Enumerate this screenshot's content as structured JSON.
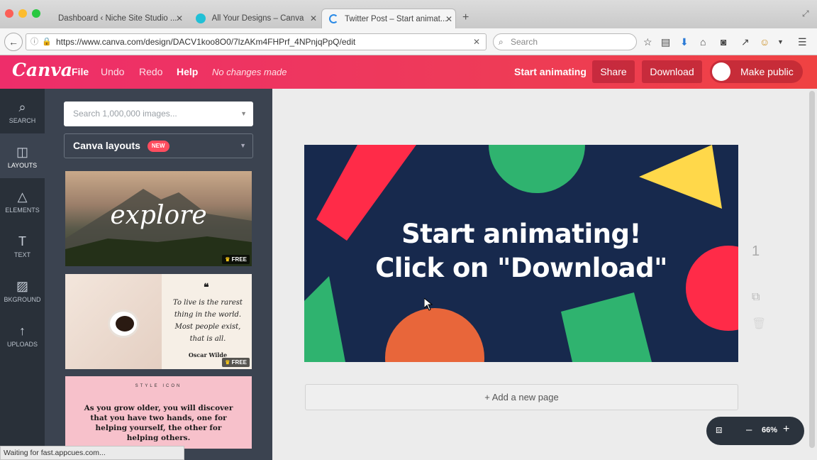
{
  "browser": {
    "tabs": [
      {
        "label": "Dashboard ‹ Niche Site Studio ..."
      },
      {
        "label": "All Your Designs – Canva"
      },
      {
        "label": "Twitter Post – Start animat..."
      }
    ],
    "url": "https://www.canva.com/design/DACV1koo8O0/7lzAKm4FHPrf_4NPnjqPpQ/edit",
    "search_placeholder": "Search"
  },
  "header": {
    "logo": "Canva",
    "menu": {
      "file": "File",
      "undo": "Undo",
      "redo": "Redo",
      "help": "Help"
    },
    "status": "No changes made",
    "start_animating": "Start animating",
    "share": "Share",
    "download": "Download",
    "make_public": "Make public"
  },
  "sidebar": {
    "items": [
      {
        "label": "SEARCH",
        "icon": "search-icon"
      },
      {
        "label": "LAYOUTS",
        "icon": "layouts-icon"
      },
      {
        "label": "ELEMENTS",
        "icon": "elements-icon"
      },
      {
        "label": "TEXT",
        "icon": "text-icon"
      },
      {
        "label": "BKGROUND",
        "icon": "background-icon"
      },
      {
        "label": "UPLOADS",
        "icon": "upload-icon"
      }
    ]
  },
  "panel": {
    "search_placeholder": "Search 1,000,000 images...",
    "category": "Canva layouts",
    "new_badge": "NEW",
    "thumbnails": [
      {
        "script": "explore",
        "badge": "FREE"
      },
      {
        "quote": "To live is the rarest thing in the world. Most people exist, that is all.",
        "author": "Oscar Wilde",
        "badge": "FREE"
      },
      {
        "kicker": "STYLE ICON",
        "quote": "As you grow older, you will discover that you have two hands, one for helping yourself, the other for helping others."
      }
    ]
  },
  "design": {
    "line1": "Start animating!",
    "line2": "Click on \"Download\"",
    "add_page": "+ Add a new page",
    "page_number": "1"
  },
  "zoom": {
    "value": "66%",
    "minus": "–",
    "plus": "+"
  },
  "status_bar": "Waiting for fast.appcues.com...",
  "colors": {
    "brand_start": "#ee2d6a",
    "brand_end": "#ef4242",
    "design_bg": "#17294d",
    "shape_red": "#ff2b48",
    "shape_green": "#2fb36f",
    "shape_yellow": "#ffd84a",
    "shape_orange": "#e8663a"
  }
}
